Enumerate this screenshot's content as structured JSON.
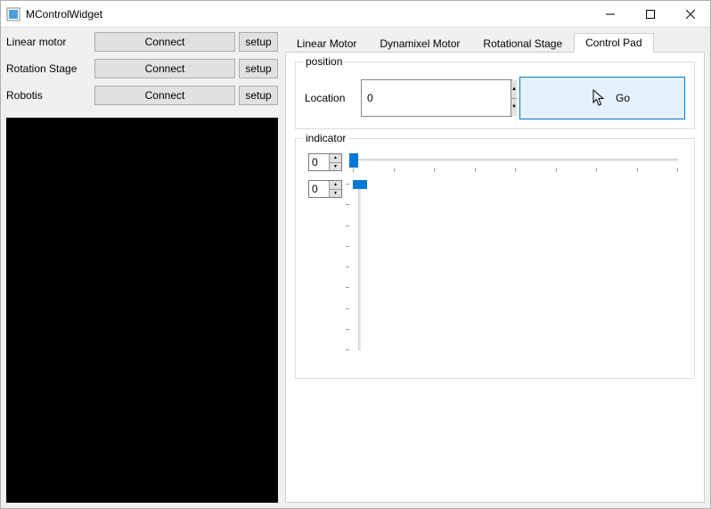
{
  "window": {
    "title": "MControlWidget"
  },
  "left": {
    "rows": [
      {
        "label": "Linear motor",
        "connect": "Connect",
        "setup": "setup"
      },
      {
        "label": "Rotation Stage",
        "connect": "Connect",
        "setup": "setup"
      },
      {
        "label": "Robotis",
        "connect": "Connect",
        "setup": "setup"
      }
    ]
  },
  "tabs": {
    "labels": [
      "Linear Motor",
      "Dynamixel Motor",
      "Rotational Stage",
      "Control Pad"
    ],
    "active": 3
  },
  "position_group": {
    "legend": "position",
    "location_label": "Location",
    "location_value": "0",
    "go_label": "Go"
  },
  "indicator_group": {
    "legend": "indicator",
    "h_value": "0",
    "v_value": "0",
    "h_ticks": 9,
    "v_ticks": 9
  }
}
